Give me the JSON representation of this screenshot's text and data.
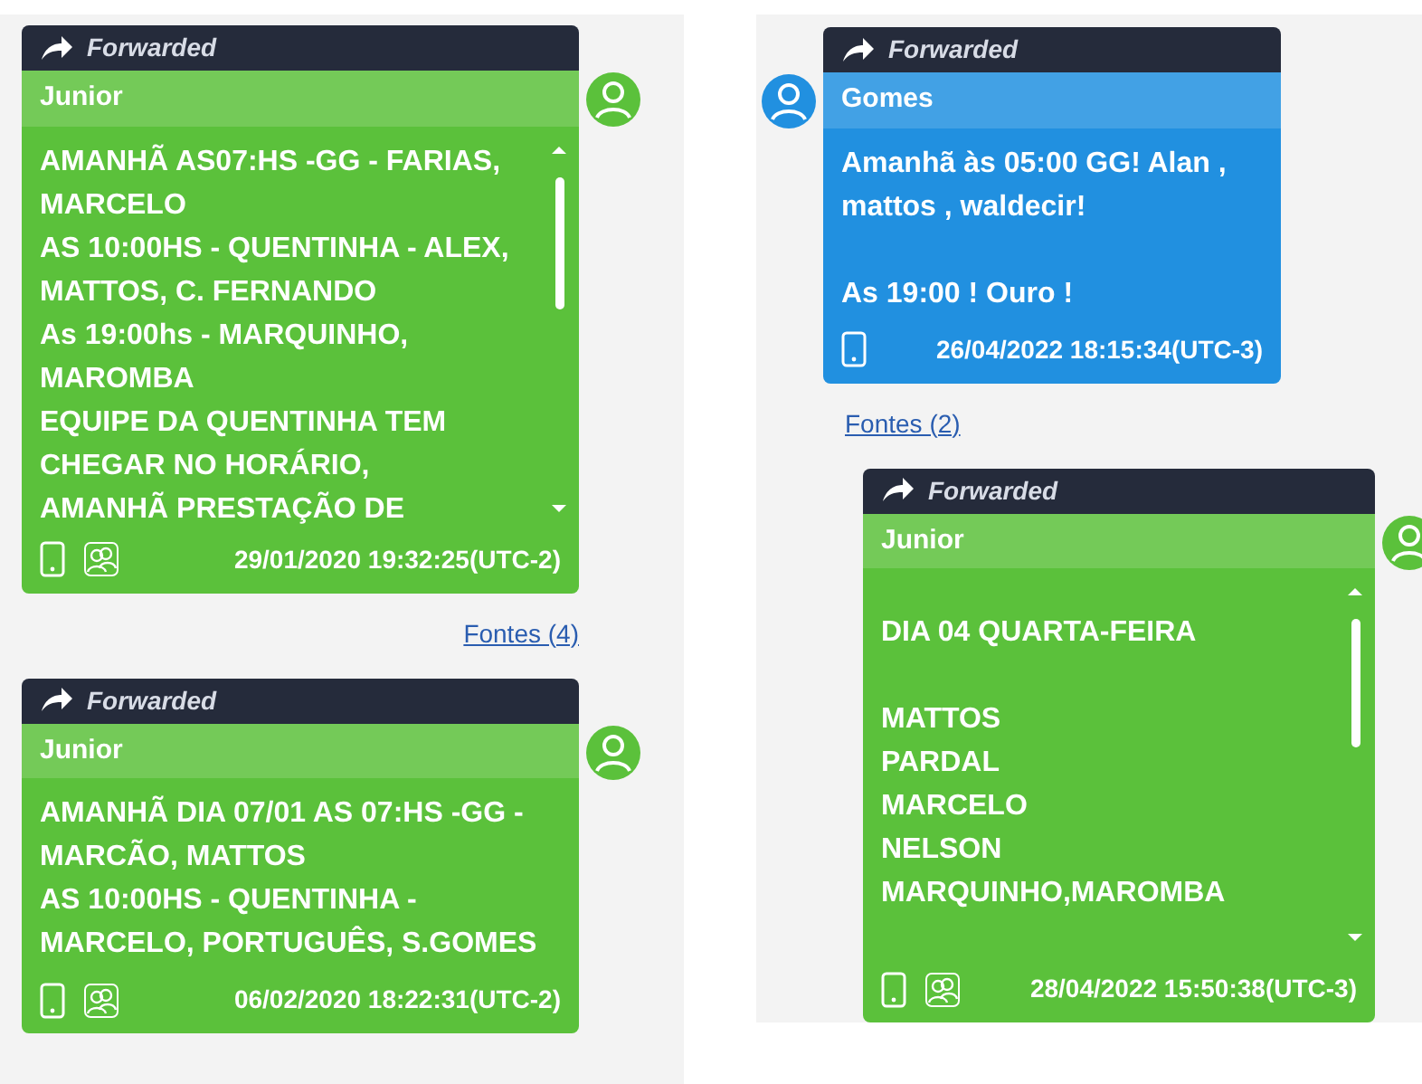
{
  "columns": [
    {
      "messages": [
        {
          "kind": "right",
          "color": "#5bc13b",
          "forwarded_label": "Forwarded",
          "sender": "Junior",
          "scrollable": true,
          "group_chat": true,
          "paragraphs": [
            [
              "AMANHÃ AS07:HS -GG - FARIAS, MARCELO",
              "AS 10:00HS - QUENTINHA - ALEX, MATTOS, C. FERNANDO",
              "As 19:00hs - MARQUINHO, MAROMBA",
              "EQUIPE DA QUENTINHA TEM CHEGAR NO HORÁRIO,",
              "AMANHÃ PRESTAÇÃO DE"
            ]
          ],
          "timestamp": "29/01/2020 19:32:25(UTC-2)",
          "sources_link": "Fontes (4)"
        },
        {
          "kind": "right",
          "color": "#5bc13b",
          "forwarded_label": "Forwarded",
          "sender": "Junior",
          "scrollable": false,
          "group_chat": true,
          "paragraphs": [
            [
              "AMANHÃ DIA 07/01 AS 07:HS -GG - MARCÃO, MATTOS",
              "AS 10:00HS  - QUENTINHA - MARCELO, PORTUGUÊS, S.GOMES"
            ]
          ],
          "timestamp": "06/02/2020 18:22:31(UTC-2)"
        }
      ]
    },
    {
      "messages": [
        {
          "kind": "left",
          "color": "#2190e0",
          "forwarded_label": "Forwarded",
          "sender": "Gomes",
          "scrollable": false,
          "group_chat": false,
          "paragraphs": [
            [
              "Amanhã às 05:00 GG! Alan , mattos , waldecir!"
            ],
            [
              "As 19:00 ! Ouro !"
            ]
          ],
          "timestamp": "26/04/2022 18:15:34(UTC-3)",
          "sources_link": "Fontes (2)"
        },
        {
          "kind": "right",
          "color": "#5bc13b",
          "forwarded_label": "Forwarded",
          "sender": "Junior",
          "scrollable": true,
          "group_chat": true,
          "paragraphs": [
            [
              "DIA 04 QUARTA-FEIRA"
            ],
            [
              "MATTOS",
              "PARDAL",
              "MARCELO",
              "NELSON",
              "MARQUINHO,MAROMBA"
            ]
          ],
          "timestamp": "28/04/2022 15:50:38(UTC-3)"
        }
      ]
    }
  ]
}
